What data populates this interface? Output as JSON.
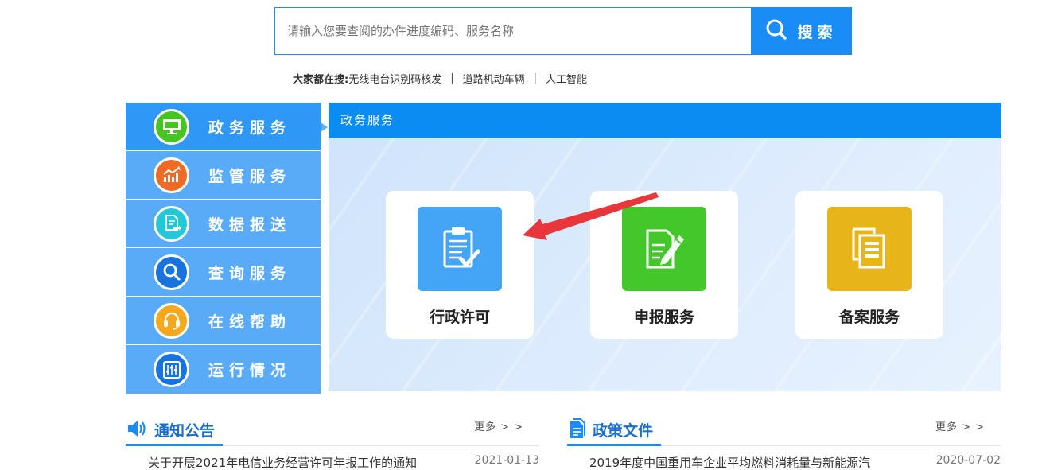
{
  "search": {
    "placeholder": "请输入您要查阅的办件进度编码、服务名称",
    "button_label": "搜索"
  },
  "hot_searches": {
    "label": "大家都在搜:",
    "items": [
      "无线电台识别码核发",
      "道路机动车辆",
      "人工智能"
    ],
    "separator": "|"
  },
  "side_menu": {
    "items": [
      {
        "label": "政务服务",
        "icon": "monitor-icon",
        "color": "#44c51f",
        "active": true
      },
      {
        "label": "监管服务",
        "icon": "chart-icon",
        "color": "#ef6a25",
        "active": false
      },
      {
        "label": "数据报送",
        "icon": "document-send-icon",
        "color": "#22c8d6",
        "active": false
      },
      {
        "label": "查询服务",
        "icon": "search-icon",
        "color": "#1673e0",
        "active": false
      },
      {
        "label": "在线帮助",
        "icon": "headset-icon",
        "color": "#f5a81c",
        "active": false
      },
      {
        "label": "运行情况",
        "icon": "sliders-icon",
        "color": "#1673e0",
        "active": false
      }
    ]
  },
  "panel": {
    "title": "政务服务",
    "cards": [
      {
        "label": "行政许可",
        "icon": "clipboard-check-icon",
        "color": "#44a5f7"
      },
      {
        "label": "申报服务",
        "icon": "document-edit-icon",
        "color": "#44c72a"
      },
      {
        "label": "备案服务",
        "icon": "copy-document-icon",
        "color": "#e7b51a"
      }
    ]
  },
  "notices": {
    "title": "通知公告",
    "more": "更多 > >",
    "items": [
      {
        "title": "关于开展2021年电信业务经营许可年报工作的通知",
        "date": "2021-01-13"
      }
    ]
  },
  "policies": {
    "title": "政策文件",
    "more": "更多 > >",
    "items": [
      {
        "title": "2019年度中国重用车企业平均燃料消耗量与新能源汽",
        "date": "2020-07-02"
      }
    ]
  },
  "colors": {
    "accent": "#1a8cf5",
    "menu_bg": "#5aabf7",
    "menu_active_bg": "#2f97f5",
    "panel_header": "#0a8cf2",
    "arrow": "#e8363a"
  }
}
